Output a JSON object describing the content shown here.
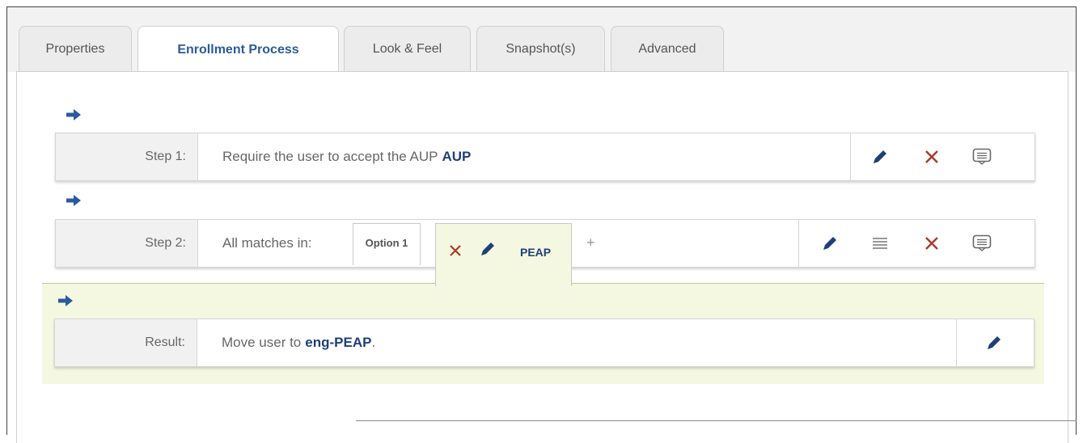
{
  "tabs": [
    {
      "label": "Properties",
      "active": false
    },
    {
      "label": "Enrollment Process",
      "active": true
    },
    {
      "label": "Look & Feel",
      "active": false
    },
    {
      "label": "Snapshot(s)",
      "active": false
    },
    {
      "label": "Advanced",
      "active": false
    }
  ],
  "step1": {
    "label": "Step 1:",
    "text": "Require the user to accept the AUP",
    "highlight": "AUP"
  },
  "step2": {
    "label": "Step 2:",
    "text": "All matches in:",
    "options": [
      {
        "label": "Option 1"
      },
      {
        "label": "PEAP"
      }
    ],
    "add_label": "+"
  },
  "result": {
    "label": "Result:",
    "text": "Move user to",
    "highlight": "eng-PEAP",
    "suffix": "."
  },
  "colors": {
    "accent": "#1f3f7a",
    "delete": "#a83a2a",
    "result_background": "#f4f8e0",
    "arrow": "#2a5aa0"
  },
  "icons": [
    "arrow-right-icon",
    "pencil-icon",
    "close-icon",
    "comment-icon",
    "list-icon"
  ]
}
